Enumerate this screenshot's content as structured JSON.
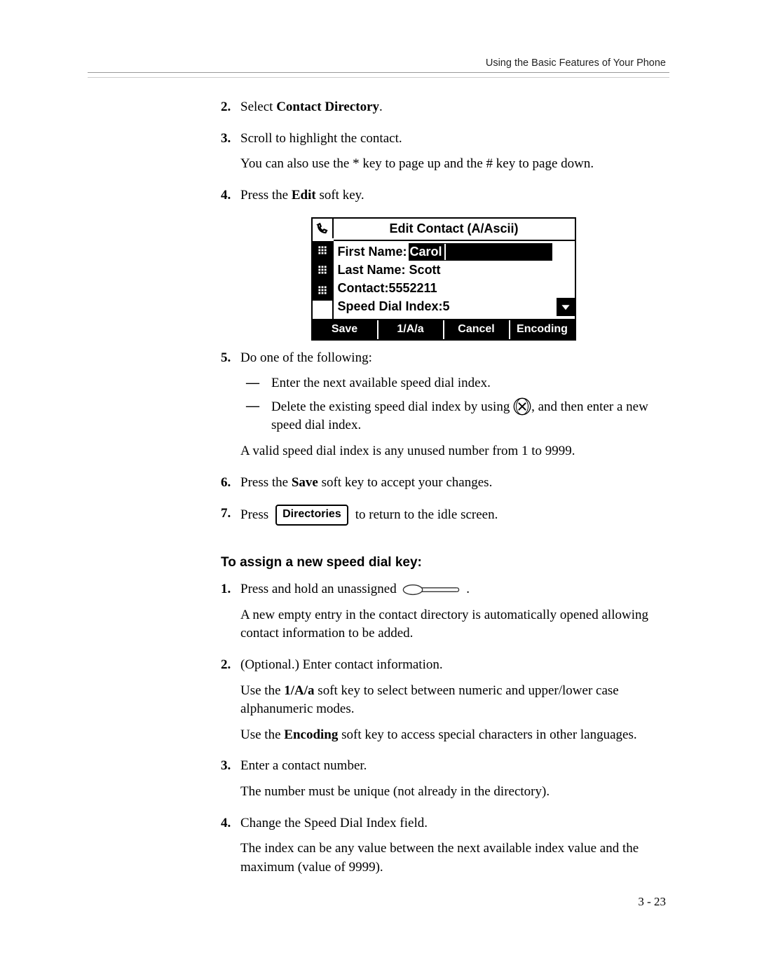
{
  "header": {
    "running": "Using the Basic Features of Your Phone"
  },
  "steps_a": {
    "s2": {
      "num": "2.",
      "t1": "Select ",
      "b": "Contact Directory",
      "t2": "."
    },
    "s3": {
      "num": "3.",
      "l1": "Scroll to highlight the contact.",
      "l2": "You can also use the * key to page up and the # key to page down."
    },
    "s4": {
      "num": "4.",
      "t1": "Press the ",
      "b": "Edit",
      "t2": " soft key."
    },
    "s5": {
      "num": "5.",
      "lead": "Do one of the following:",
      "d1": "Enter the next available speed dial index.",
      "d2a": "Delete the existing speed dial index by using ",
      "d2b": ", and then enter a new speed dial index.",
      "after": "A valid speed dial index is any unused number from 1 to 9999."
    },
    "s6": {
      "num": "6.",
      "t1": "Press the ",
      "b": "Save",
      "t2": " soft key to accept your changes."
    },
    "s7": {
      "num": "7.",
      "t1": "Press",
      "btn": "Directories",
      "t2": "to return to the idle screen."
    }
  },
  "phone": {
    "title": "Edit Contact (A/Ascii)",
    "f1_label": "First Name:",
    "f1_val": "Carol",
    "f2_label": "Last Name:",
    "f2_val": "Scott",
    "f3_label": "Contact:",
    "f3_val": "5552211",
    "f4_label": "Speed Dial Index:",
    "f4_val": "5",
    "sk1": "Save",
    "sk2": "1/A/a",
    "sk3": "Cancel",
    "sk4": "Encoding"
  },
  "heading2": "To assign a new speed dial key:",
  "steps_b": {
    "s1": {
      "num": "1.",
      "l1a": "Press and hold an unassigned ",
      "l1b": ".",
      "l2": "A new empty entry in the contact directory is automatically opened allowing contact information to be added."
    },
    "s2": {
      "num": "2.",
      "l1": "(Optional.) Enter contact information.",
      "l2a": "Use the ",
      "l2b": "1/A/a",
      "l2c": " soft key to select between numeric and upper/lower case alphanumeric modes.",
      "l3a": "Use the ",
      "l3b": "Encoding",
      "l3c": " soft key to access special characters in other languages."
    },
    "s3": {
      "num": "3.",
      "l1": "Enter a contact number.",
      "l2": "The number must be unique (not already in the directory)."
    },
    "s4": {
      "num": "4.",
      "l1": "Change the Speed Dial Index field.",
      "l2": "The index can be any value between the next available index value and the maximum (value of 9999)."
    }
  },
  "footer": "3 - 23"
}
